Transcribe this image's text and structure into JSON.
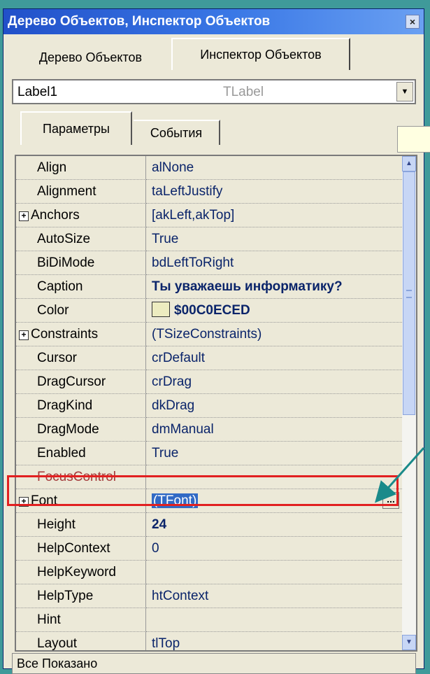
{
  "window": {
    "title": "Дерево Объектов, Инспектор Объектов",
    "close_label": "×"
  },
  "outer_tabs": [
    {
      "label": "Дерево Объектов",
      "active": false
    },
    {
      "label": "Инспектор Объектов",
      "active": true
    }
  ],
  "object_selector": {
    "name": "Label1",
    "type": "TLabel",
    "dropdown_glyph": "▼"
  },
  "inner_tabs": [
    {
      "label": "Параметры",
      "active": true
    },
    {
      "label": "События",
      "active": false
    }
  ],
  "properties": [
    {
      "name": "Align",
      "value": "alNone"
    },
    {
      "name": "Alignment",
      "value": "taLeftJustify"
    },
    {
      "name": "Anchors",
      "value": "[akLeft,akTop]",
      "expandable": true
    },
    {
      "name": "AutoSize",
      "value": "True"
    },
    {
      "name": "BiDiMode",
      "value": "bdLeftToRight"
    },
    {
      "name": "Caption",
      "value": "Ты уважаешь информатику?"
    },
    {
      "name": "Color",
      "value": "$00C0ECED"
    },
    {
      "name": "Constraints",
      "value": "(TSizeConstraints)",
      "expandable": true
    },
    {
      "name": "Cursor",
      "value": "crDefault"
    },
    {
      "name": "DragCursor",
      "value": "crDrag"
    },
    {
      "name": "DragKind",
      "value": "dkDrag"
    },
    {
      "name": "DragMode",
      "value": "dmManual"
    },
    {
      "name": "Enabled",
      "value": "True"
    },
    {
      "name": "FocusControl",
      "value": ""
    },
    {
      "name": "Font",
      "value": "(TFont)",
      "expandable": true,
      "selected": true
    },
    {
      "name": "Height",
      "value": "24"
    },
    {
      "name": "HelpContext",
      "value": "0"
    },
    {
      "name": "HelpKeyword",
      "value": ""
    },
    {
      "name": "HelpType",
      "value": "htContext"
    },
    {
      "name": "Hint",
      "value": ""
    },
    {
      "name": "Layout",
      "value": "tlTop"
    }
  ],
  "ellipsis_label": "...",
  "expand_glyph": "+",
  "scroll_up_glyph": "▲",
  "scroll_down_glyph": "▼",
  "colors": {
    "title_bar": "#2150c9",
    "highlight_box": "#e22020",
    "arrow": "#1a8a8a",
    "selection": "#316ac5",
    "background": "#3f9a9a"
  },
  "status_text": "Все Показано"
}
